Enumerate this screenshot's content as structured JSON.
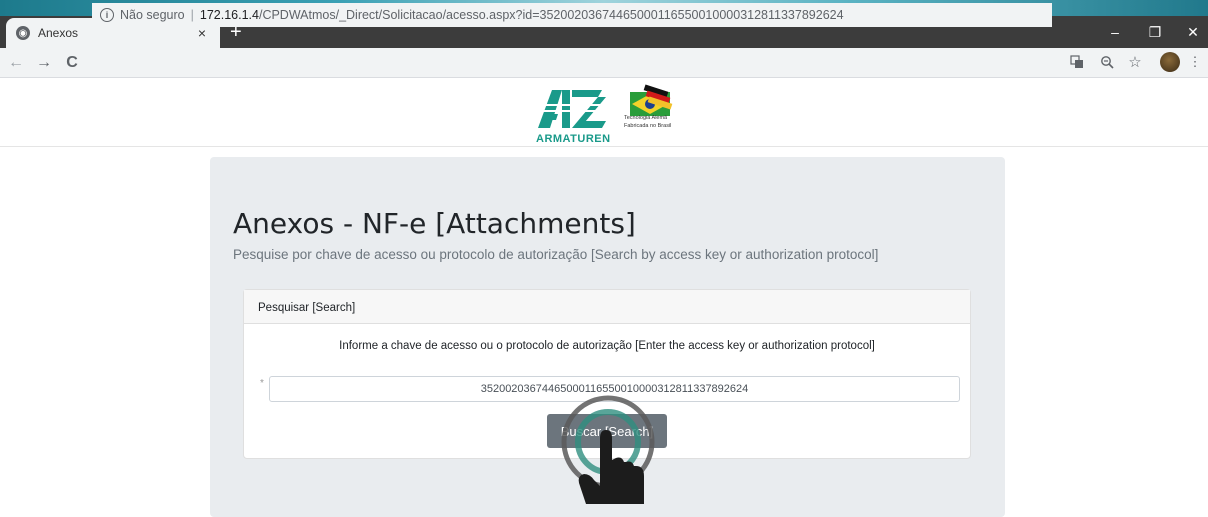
{
  "browser": {
    "tab_title": "Anexos",
    "tab_close": "×",
    "new_tab": "+",
    "window_controls": {
      "minimize": "–",
      "restore": "❐",
      "close": "✕"
    },
    "nav": {
      "back": "←",
      "forward": "→",
      "reload": "C"
    },
    "address": {
      "security_label": "Não seguro",
      "separator": "|",
      "host": "172.16.1.4",
      "path": "/CPDWAtmos/_Direct/Solicitacao/acesso.aspx?id=35200203674465000116550010000312811337892624"
    },
    "toolbar_icons": [
      "translate-icon",
      "zoom-icon",
      "star-icon",
      "avatar",
      "menu-icon"
    ]
  },
  "brand": {
    "name": "ARMATUREN",
    "tagline_1": "Tecnologia Alemã",
    "tagline_2": "Fabricada no Brasil",
    "colors": {
      "primary": "#1a9a8a"
    }
  },
  "page": {
    "title": "Anexos - NF-e [Attachments]",
    "lead": "Pesquise por chave de acesso ou protocolo de autorização [Search by access key or authorization protocol]"
  },
  "search_card": {
    "header": "Pesquisar [Search]",
    "instruction": "Informe a chave de acesso ou o protocolo de autorização [Enter the access key or authorization protocol]",
    "required_marker": "*",
    "input_value": "35200203674465000116550010000312811337892624",
    "button_label": "Buscar [Search]"
  }
}
